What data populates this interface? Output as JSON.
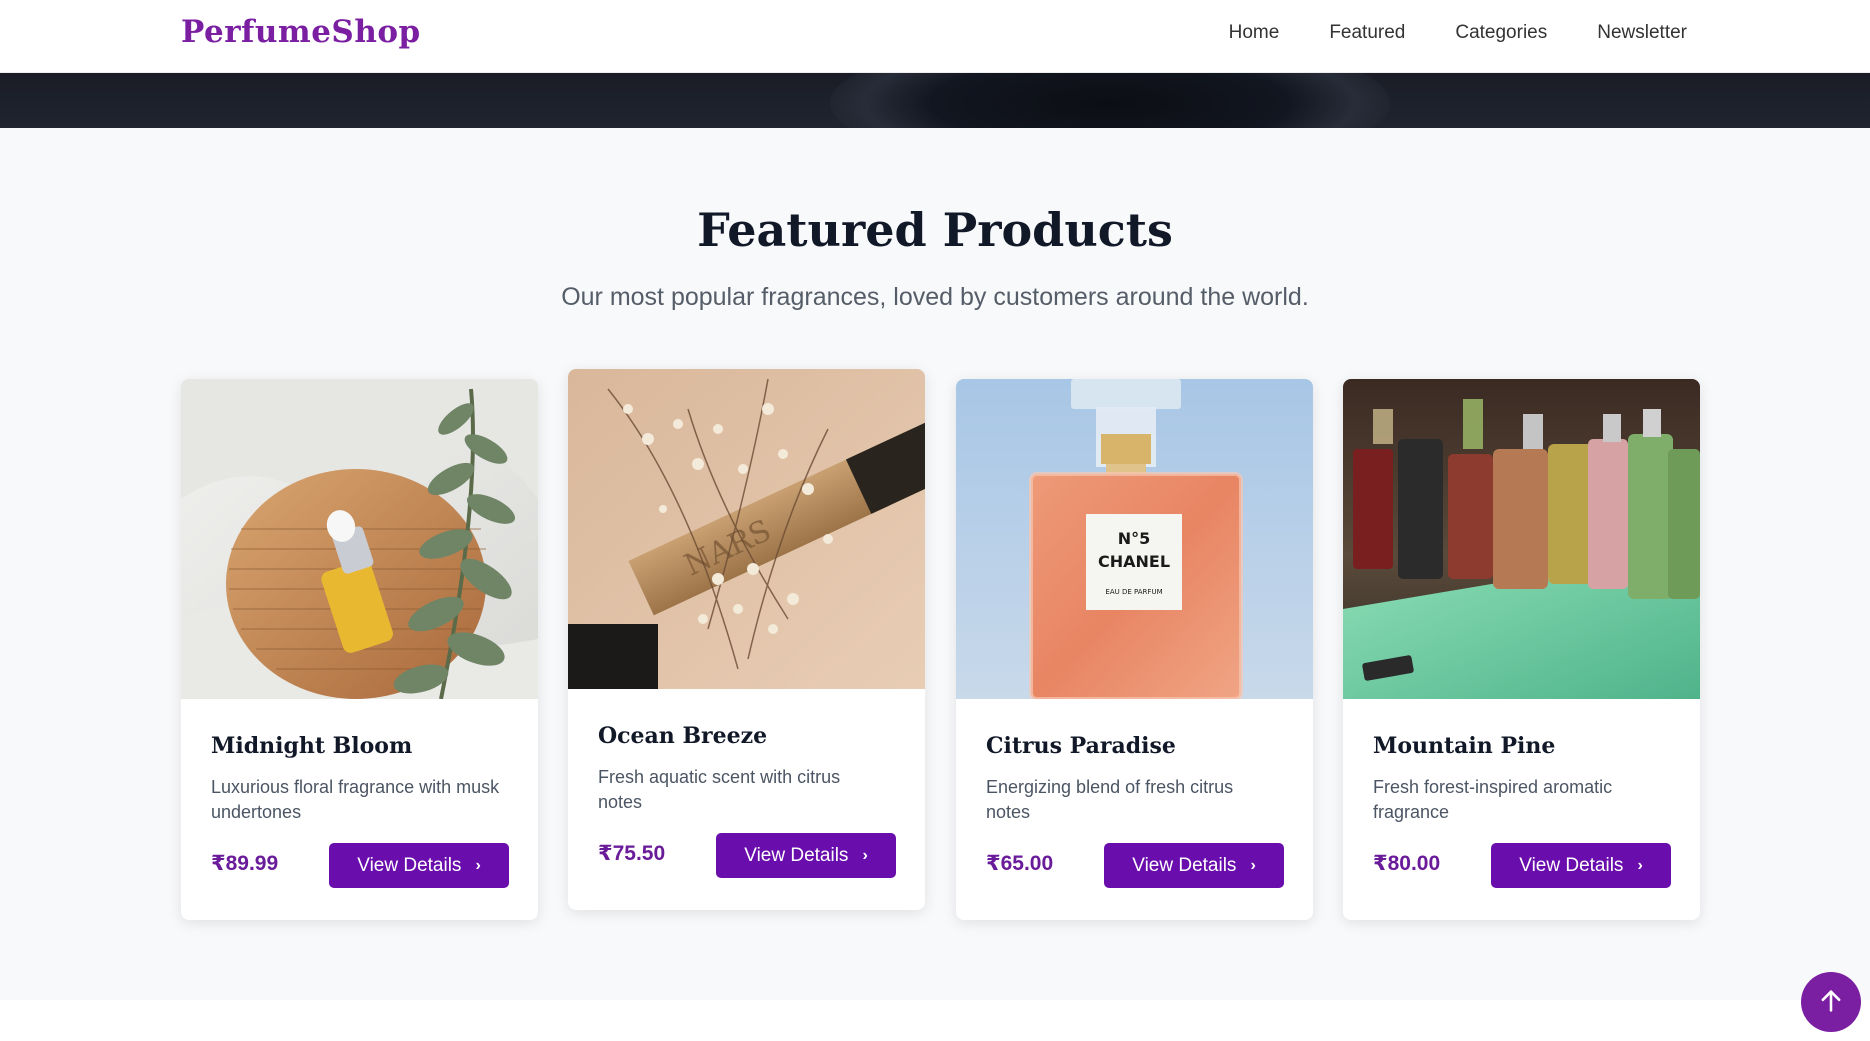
{
  "header": {
    "brand": "PerfumeShop",
    "nav": [
      "Home",
      "Featured",
      "Categories",
      "Newsletter"
    ]
  },
  "featured": {
    "title": "Featured Products",
    "subtitle": "Our most popular fragrances, loved by customers around the world.",
    "products": [
      {
        "name": "Midnight Bloom",
        "description": "Luxurious floral fragrance with musk undertones",
        "price": "₹89.99",
        "button": "View Details",
        "image_label": "serum dropper bottle with eucalyptus leaves"
      },
      {
        "name": "Ocean Breeze",
        "description": "Fresh aquatic scent with citrus notes",
        "price": "₹75.50",
        "button": "View Details",
        "image_label": "NARS product with dried baby's breath",
        "brand_text": "NARS"
      },
      {
        "name": "Citrus Paradise",
        "description": "Energizing blend of fresh citrus notes",
        "price": "₹65.00",
        "button": "View Details",
        "image_label": "Chanel No 5 perfume bottle",
        "label_line1": "N°5",
        "label_line2": "CHANEL",
        "label_line3": "EAU DE PARFUM"
      },
      {
        "name": "Mountain Pine",
        "description": "Fresh forest-inspired aromatic fragrance",
        "price": "₹80.00",
        "button": "View Details",
        "image_label": "row of perfume bottles on a green lit display"
      }
    ]
  },
  "colors": {
    "brand": "#7b1fa2",
    "button": "#6a0dad",
    "price": "#6a1b9a",
    "section_bg": "#f8f9fb"
  },
  "icons": {
    "button_chevron": "chevron-right-icon",
    "scroll_top": "arrow-up-icon"
  }
}
